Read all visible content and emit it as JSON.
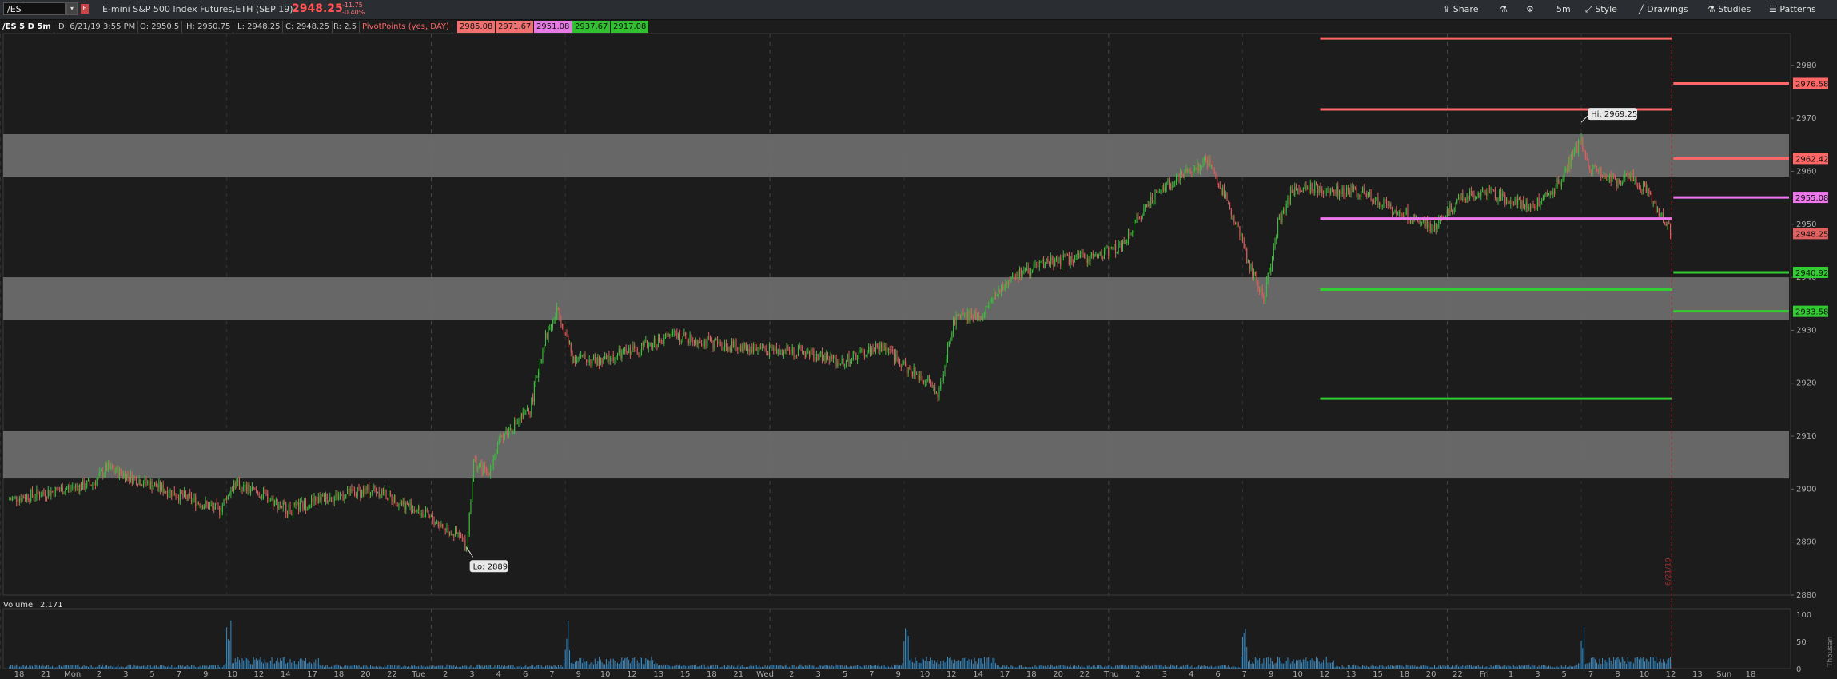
{
  "topbar": {
    "symbol": "/ES",
    "flag_label": "E",
    "description": "E-mini S&P 500 Index Futures,ETH (SEP 19)",
    "last_price": "2948.25",
    "net_change": "-11.75",
    "pct_change": "-0.40%",
    "buttons": {
      "share": "Share",
      "timeframe": "5m",
      "style": "Style",
      "drawings": "Drawings",
      "studies": "Studies",
      "patterns": "Patterns"
    }
  },
  "infobar": {
    "title": "/ES 5 D 5m",
    "date": "D: 6/21/19 3:55 PM",
    "open": "O: 2950.5",
    "high": "H: 2950.75",
    "low": "L: 2948.25",
    "close": "C: 2948.25",
    "range": "R: 2.5",
    "study": "PivotPoints (yes, DAY)",
    "pivots": [
      "2985.08",
      "2971.67",
      "2951.08",
      "2937.67",
      "2917.08"
    ]
  },
  "colors": {
    "bull": "#3fbf3f",
    "bear": "#e06060",
    "r_line": "#ff6666",
    "pp_line": "#ee77ee",
    "s_line": "#33cc33",
    "zone": "#6e6e6e",
    "volume": "#3a8cc4",
    "background": "#1c1c1c"
  },
  "chart_data": {
    "type": "candlestick",
    "ylim": [
      2880,
      2986
    ],
    "yticks": [
      2880,
      2890,
      2900,
      2910,
      2920,
      2930,
      2940,
      2950,
      2960,
      2970,
      2980
    ],
    "x_ticks": [
      "18",
      "21",
      "Mon",
      "2",
      "3",
      "5",
      "7",
      "9",
      "10",
      "12",
      "14",
      "17",
      "18",
      "20",
      "22",
      "Tue",
      "2",
      "3",
      "4",
      "6",
      "7",
      "9",
      "10",
      "12",
      "13",
      "15",
      "18",
      "21",
      "Wed",
      "2",
      "3",
      "5",
      "7",
      "9",
      "10",
      "12",
      "14",
      "17",
      "18",
      "20",
      "22",
      "Thu",
      "2",
      "3",
      "4",
      "6",
      "7",
      "9",
      "10",
      "12",
      "13",
      "15",
      "18",
      "20",
      "22",
      "Fri",
      "1",
      "3",
      "5",
      "7",
      "8",
      "10",
      "12",
      "13",
      "Sun",
      "18"
    ],
    "price_path": [
      [
        "Sun 18:00",
        2898
      ],
      [
        "Mon 00:00",
        2901
      ],
      [
        "Mon 01:00",
        2904
      ],
      [
        "Mon 03:00",
        2902
      ],
      [
        "Mon 06:00",
        2899
      ],
      [
        "Mon 09:00",
        2896
      ],
      [
        "Mon 10:00",
        2901
      ],
      [
        "Mon 12:00",
        2899
      ],
      [
        "Mon 14:00",
        2896
      ],
      [
        "Mon 16:00",
        2898
      ],
      [
        "Mon 20:00",
        2900
      ],
      [
        "Mon 23:00",
        2896
      ],
      [
        "Tue 02:00",
        2891
      ],
      [
        "Tue 02:30",
        2889
      ],
      [
        "Tue 03:00",
        2905
      ],
      [
        "Tue 04:00",
        2903
      ],
      [
        "Tue 05:00",
        2910
      ],
      [
        "Tue 07:00",
        2915
      ],
      [
        "Tue 08:00",
        2928
      ],
      [
        "Tue 09:00",
        2934
      ],
      [
        "Tue 10:00",
        2925
      ],
      [
        "Tue 12:00",
        2924
      ],
      [
        "Tue 14:00",
        2926
      ],
      [
        "Tue 17:00",
        2929
      ],
      [
        "Tue 21:00",
        2927
      ],
      [
        "Wed 02:00",
        2926
      ],
      [
        "Wed 05:00",
        2924
      ],
      [
        "Wed 08:00",
        2927
      ],
      [
        "Wed 10:00",
        2922
      ],
      [
        "Wed 11:00",
        2921
      ],
      [
        "Wed 12:00",
        2918
      ],
      [
        "Wed 13:00",
        2932
      ],
      [
        "Wed 15:00",
        2933
      ],
      [
        "Wed 17:00",
        2940
      ],
      [
        "Wed 20:00",
        2943
      ],
      [
        "Wed 23:00",
        2944
      ],
      [
        "Thu 01:00",
        2946
      ],
      [
        "Thu 03:00",
        2955
      ],
      [
        "Thu 05:00",
        2959
      ],
      [
        "Thu 07:00",
        2962
      ],
      [
        "Thu 09:00",
        2951
      ],
      [
        "Thu 10:00",
        2942
      ],
      [
        "Thu 11:00",
        2936
      ],
      [
        "Thu 12:00",
        2950
      ],
      [
        "Thu 13:00",
        2956
      ],
      [
        "Thu 14:00",
        2957
      ],
      [
        "Thu 18:00",
        2956
      ],
      [
        "Thu 21:00",
        2952
      ],
      [
        "Thu 23:00",
        2949
      ],
      [
        "Fri 01:00",
        2955
      ],
      [
        "Fri 03:00",
        2956
      ],
      [
        "Fri 06:00",
        2953
      ],
      [
        "Fri 08:00",
        2958
      ],
      [
        "Fri 09:30",
        2966
      ],
      [
        "Fri 10:00",
        2961
      ],
      [
        "Fri 12:00",
        2958
      ],
      [
        "Fri 13:00",
        2959
      ],
      [
        "Fri 14:00",
        2957
      ],
      [
        "Fri 15:55",
        2948.25
      ]
    ],
    "gray_zones": [
      [
        2959,
        2967
      ],
      [
        2932,
        2940
      ],
      [
        2902,
        2911
      ]
    ],
    "pivot_lines_today": [
      {
        "value": 2985.08,
        "kind": "R"
      },
      {
        "value": 2971.67,
        "kind": "R"
      },
      {
        "value": 2951.08,
        "kind": "PP"
      },
      {
        "value": 2937.67,
        "kind": "S"
      },
      {
        "value": 2917.08,
        "kind": "S"
      }
    ],
    "pivot_lines_next": [
      {
        "value": 2976.58,
        "kind": "R"
      },
      {
        "value": 2962.42,
        "kind": "R"
      },
      {
        "value": 2955.08,
        "kind": "PP"
      },
      {
        "value": 2940.92,
        "kind": "S"
      },
      {
        "value": 2933.58,
        "kind": "S"
      }
    ],
    "annotations": {
      "high": "Hi: 2969.25",
      "low": "Lo: 2889",
      "cursor_date": "6/21/19"
    },
    "volume": {
      "label": "Volume",
      "value": "2,171",
      "yticks": [
        "100",
        "50",
        "0"
      ],
      "unit": "Thousan"
    }
  }
}
